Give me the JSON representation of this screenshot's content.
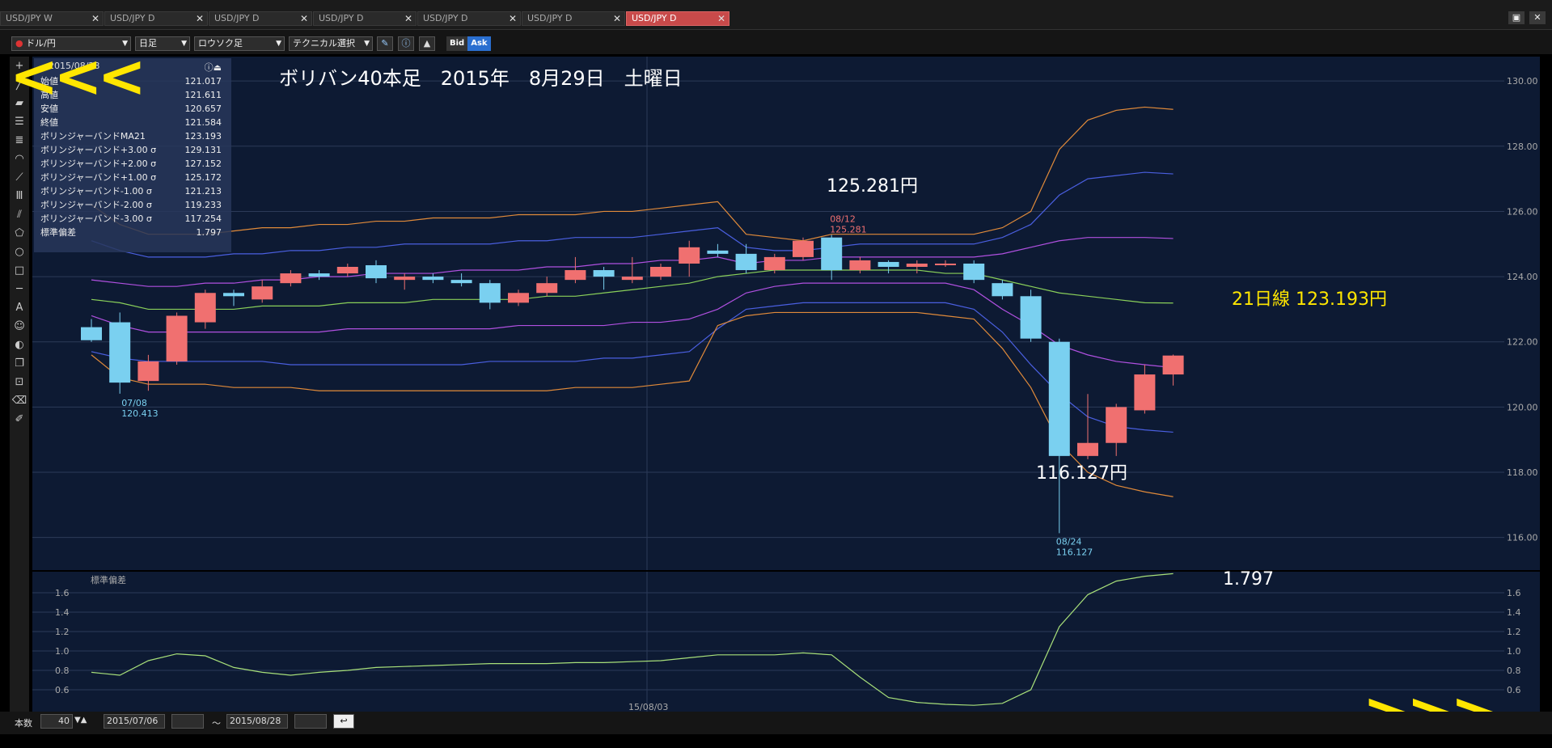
{
  "tabs": [
    {
      "label": "USD/JPY W",
      "active": false
    },
    {
      "label": "USD/JPY D",
      "active": false
    },
    {
      "label": "USD/JPY D",
      "active": false
    },
    {
      "label": "USD/JPY D",
      "active": false
    },
    {
      "label": "USD/JPY D",
      "active": false
    },
    {
      "label": "USD/JPY D",
      "active": false
    },
    {
      "label": "USD/JPY D",
      "active": true
    }
  ],
  "toolbar": {
    "pair": "ドル/円",
    "timeframe": "日足",
    "chart_type": "ロウソク足",
    "technical": "テクニカル選択",
    "bid": "Bid",
    "ask": "Ask"
  },
  "info": {
    "date": "2015/08/28",
    "rows": [
      {
        "label": "始値",
        "value": "121.017"
      },
      {
        "label": "高値",
        "value": "121.611"
      },
      {
        "label": "安値",
        "value": "120.657"
      },
      {
        "label": "終値",
        "value": "121.584"
      },
      {
        "label": "ボリンジャーバンドMA21",
        "value": "123.193"
      },
      {
        "label": "ボリンジャーバンド+3.00 σ",
        "value": "129.131"
      },
      {
        "label": "ボリンジャーバンド+2.00 σ",
        "value": "127.152"
      },
      {
        "label": "ボリンジャーバンド+1.00 σ",
        "value": "125.172"
      },
      {
        "label": "ボリンジャーバンド-1.00 σ",
        "value": "121.213"
      },
      {
        "label": "ボリンジャーバンド-2.00 σ",
        "value": "119.233"
      },
      {
        "label": "ボリンジャーバンド-3.00 σ",
        "value": "117.254"
      },
      {
        "label": "標準偏差",
        "value": "1.797"
      }
    ]
  },
  "annotations": {
    "title": "ボリバン40本足　2015年　8月29日　土曜日",
    "high": "125.281円",
    "low": "116.127円",
    "ma21": "21日線 123.193円",
    "stdev": "1.797",
    "high_tag_date": "08/12",
    "high_tag_value": "125.281",
    "low_tag_date": "08/24",
    "low_tag_value": "116.127",
    "start_tag_date": "07/08",
    "start_tag_value": "120.413"
  },
  "sub_label": "標準偏差",
  "x_label": "15/08/03",
  "bottom": {
    "count_label": "本数",
    "count": "40",
    "from": "2015/07/06",
    "to": "2015/08/28",
    "tilde": "～"
  },
  "nav": {
    "back": "<<<",
    "forward": ">>>"
  },
  "chart_data": {
    "type": "candlestick",
    "ylim": [
      115,
      130.5
    ],
    "yticks": [
      116,
      118,
      120,
      122,
      124,
      126,
      128,
      130
    ],
    "candles": [
      {
        "o": 122.45,
        "h": 122.7,
        "l": 122.0,
        "c": 122.05
      },
      {
        "o": 122.6,
        "h": 122.9,
        "l": 120.41,
        "c": 120.75
      },
      {
        "o": 120.8,
        "h": 121.6,
        "l": 120.5,
        "c": 121.4
      },
      {
        "o": 121.4,
        "h": 122.9,
        "l": 121.3,
        "c": 122.8
      },
      {
        "o": 122.6,
        "h": 123.6,
        "l": 122.4,
        "c": 123.5
      },
      {
        "o": 123.5,
        "h": 123.6,
        "l": 123.1,
        "c": 123.4
      },
      {
        "o": 123.3,
        "h": 123.9,
        "l": 123.2,
        "c": 123.7
      },
      {
        "o": 123.8,
        "h": 124.2,
        "l": 123.7,
        "c": 124.1
      },
      {
        "o": 124.1,
        "h": 124.2,
        "l": 123.9,
        "c": 124.0
      },
      {
        "o": 124.1,
        "h": 124.4,
        "l": 124.0,
        "c": 124.3
      },
      {
        "o": 124.35,
        "h": 124.5,
        "l": 123.8,
        "c": 123.95
      },
      {
        "o": 123.9,
        "h": 124.1,
        "l": 123.6,
        "c": 124.0
      },
      {
        "o": 124.0,
        "h": 124.1,
        "l": 123.8,
        "c": 123.9
      },
      {
        "o": 123.9,
        "h": 124.1,
        "l": 123.7,
        "c": 123.8
      },
      {
        "o": 123.8,
        "h": 123.9,
        "l": 123.0,
        "c": 123.2
      },
      {
        "o": 123.2,
        "h": 123.6,
        "l": 123.1,
        "c": 123.5
      },
      {
        "o": 123.5,
        "h": 124.0,
        "l": 123.4,
        "c": 123.8
      },
      {
        "o": 123.9,
        "h": 124.6,
        "l": 123.8,
        "c": 124.2
      },
      {
        "o": 124.2,
        "h": 124.3,
        "l": 123.6,
        "c": 124.0
      },
      {
        "o": 123.9,
        "h": 124.6,
        "l": 123.8,
        "c": 124.0
      },
      {
        "o": 124.0,
        "h": 124.4,
        "l": 123.9,
        "c": 124.3
      },
      {
        "o": 124.4,
        "h": 125.1,
        "l": 124.0,
        "c": 124.9
      },
      {
        "o": 124.8,
        "h": 125.0,
        "l": 124.6,
        "c": 124.7
      },
      {
        "o": 124.7,
        "h": 125.0,
        "l": 124.1,
        "c": 124.2
      },
      {
        "o": 124.2,
        "h": 124.7,
        "l": 124.1,
        "c": 124.6
      },
      {
        "o": 124.6,
        "h": 125.2,
        "l": 124.5,
        "c": 125.1
      },
      {
        "o": 125.2,
        "h": 125.28,
        "l": 123.9,
        "c": 124.2
      },
      {
        "o": 124.2,
        "h": 124.6,
        "l": 124.1,
        "c": 124.5
      },
      {
        "o": 124.45,
        "h": 124.5,
        "l": 124.1,
        "c": 124.3
      },
      {
        "o": 124.3,
        "h": 124.5,
        "l": 124.1,
        "c": 124.4
      },
      {
        "o": 124.4,
        "h": 124.5,
        "l": 124.3,
        "c": 124.4
      },
      {
        "o": 124.4,
        "h": 124.5,
        "l": 123.8,
        "c": 123.9
      },
      {
        "o": 123.8,
        "h": 123.9,
        "l": 123.3,
        "c": 123.4
      },
      {
        "o": 123.4,
        "h": 123.6,
        "l": 122.0,
        "c": 122.1
      },
      {
        "o": 122.0,
        "h": 122.1,
        "l": 116.13,
        "c": 118.5
      },
      {
        "o": 118.5,
        "h": 120.4,
        "l": 118.4,
        "c": 118.9
      },
      {
        "o": 118.9,
        "h": 120.1,
        "l": 118.5,
        "c": 120.0
      },
      {
        "o": 119.9,
        "h": 121.3,
        "l": 119.8,
        "c": 121.0
      },
      {
        "o": 121.0,
        "h": 121.61,
        "l": 120.66,
        "c": 121.58
      }
    ],
    "bands": {
      "upper3": [
        126.2,
        125.6,
        125.3,
        125.3,
        125.3,
        125.4,
        125.5,
        125.5,
        125.6,
        125.6,
        125.7,
        125.7,
        125.8,
        125.8,
        125.8,
        125.9,
        125.9,
        125.9,
        126.0,
        126.0,
        126.1,
        126.2,
        126.3,
        125.3,
        125.2,
        125.1,
        125.3,
        125.3,
        125.3,
        125.3,
        125.3,
        125.3,
        125.5,
        126.0,
        127.9,
        128.8,
        129.1,
        129.2,
        129.13
      ],
      "upper2": [
        125.1,
        124.8,
        124.6,
        124.6,
        124.6,
        124.7,
        124.7,
        124.8,
        124.8,
        124.9,
        124.9,
        125.0,
        125.0,
        125.0,
        125.0,
        125.1,
        125.1,
        125.2,
        125.2,
        125.2,
        125.3,
        125.4,
        125.5,
        124.9,
        124.8,
        124.8,
        124.9,
        125.0,
        125.0,
        125.0,
        125.0,
        125.0,
        125.2,
        125.6,
        126.5,
        127.0,
        127.1,
        127.2,
        127.15
      ],
      "upper1": [
        123.9,
        123.8,
        123.7,
        123.7,
        123.8,
        123.8,
        123.9,
        123.9,
        124.0,
        124.0,
        124.1,
        124.1,
        124.1,
        124.2,
        124.2,
        124.2,
        124.3,
        124.3,
        124.4,
        124.4,
        124.5,
        124.5,
        124.6,
        124.4,
        124.5,
        124.5,
        124.6,
        124.6,
        124.6,
        124.6,
        124.6,
        124.6,
        124.7,
        124.9,
        125.1,
        125.2,
        125.2,
        125.2,
        125.17
      ],
      "ma21": [
        123.3,
        123.2,
        123.0,
        123.0,
        123.0,
        123.0,
        123.1,
        123.1,
        123.1,
        123.2,
        123.2,
        123.2,
        123.3,
        123.3,
        123.3,
        123.3,
        123.4,
        123.4,
        123.5,
        123.6,
        123.7,
        123.8,
        124.0,
        124.1,
        124.2,
        124.2,
        124.2,
        124.2,
        124.2,
        124.2,
        124.1,
        124.1,
        123.9,
        123.7,
        123.5,
        123.4,
        123.3,
        123.2,
        123.19
      ],
      "lower1": [
        122.8,
        122.5,
        122.3,
        122.3,
        122.3,
        122.3,
        122.3,
        122.3,
        122.3,
        122.4,
        122.4,
        122.4,
        122.4,
        122.4,
        122.4,
        122.5,
        122.5,
        122.5,
        122.5,
        122.6,
        122.6,
        122.7,
        123.0,
        123.5,
        123.7,
        123.8,
        123.8,
        123.8,
        123.8,
        123.8,
        123.8,
        123.6,
        123.0,
        122.5,
        121.9,
        121.6,
        121.4,
        121.3,
        121.21
      ],
      "lower2": [
        121.7,
        121.5,
        121.4,
        121.4,
        121.4,
        121.4,
        121.4,
        121.3,
        121.3,
        121.3,
        121.3,
        121.3,
        121.3,
        121.3,
        121.4,
        121.4,
        121.4,
        121.4,
        121.5,
        121.5,
        121.6,
        121.7,
        122.4,
        123.0,
        123.1,
        123.2,
        123.2,
        123.2,
        123.2,
        123.2,
        123.2,
        123.0,
        122.3,
        121.3,
        120.4,
        119.7,
        119.4,
        119.3,
        119.23
      ],
      "lower3": [
        121.6,
        120.9,
        120.7,
        120.7,
        120.7,
        120.6,
        120.6,
        120.6,
        120.5,
        120.5,
        120.5,
        120.5,
        120.5,
        120.5,
        120.5,
        120.5,
        120.5,
        120.6,
        120.6,
        120.6,
        120.7,
        120.8,
        122.5,
        122.8,
        122.9,
        122.9,
        122.9,
        122.9,
        122.9,
        122.9,
        122.8,
        122.7,
        121.8,
        120.6,
        118.9,
        118.0,
        117.6,
        117.4,
        117.25
      ]
    },
    "stdev": {
      "ylim": [
        0.4,
        1.75
      ],
      "yticks": [
        0.6,
        0.8,
        1.0,
        1.2,
        1.4,
        1.6
      ],
      "values": [
        0.78,
        0.75,
        0.9,
        0.97,
        0.95,
        0.83,
        0.78,
        0.75,
        0.78,
        0.8,
        0.83,
        0.84,
        0.85,
        0.86,
        0.87,
        0.87,
        0.87,
        0.88,
        0.88,
        0.89,
        0.9,
        0.93,
        0.96,
        0.96,
        0.96,
        0.98,
        0.96,
        0.73,
        0.52,
        0.47,
        0.45,
        0.44,
        0.46,
        0.6,
        1.25,
        1.58,
        1.72,
        1.77,
        1.797
      ]
    }
  }
}
